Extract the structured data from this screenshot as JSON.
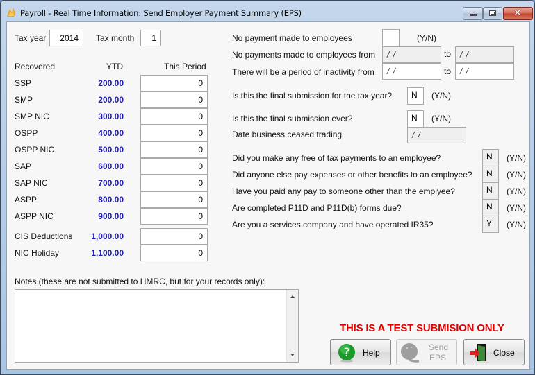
{
  "window": {
    "title": "Payroll - Real Time Information: Send Employer Payment Summary (EPS)",
    "app_icon": "payroll-flame-icon",
    "controls": {
      "minimize": "minimize-icon",
      "maximize": "maximize-icon",
      "close": "close-icon"
    }
  },
  "period": {
    "tax_year_label": "Tax year",
    "tax_year": "2014",
    "tax_month_label": "Tax month",
    "tax_month": "1"
  },
  "recovered": {
    "headers": {
      "item": "Recovered",
      "ytd": "YTD",
      "this_period": "This Period"
    },
    "rows": [
      {
        "label": "SSP",
        "ytd": "200.00",
        "this_period": "0"
      },
      {
        "label": "SMP",
        "ytd": "200.00",
        "this_period": "0"
      },
      {
        "label": "SMP NIC",
        "ytd": "300.00",
        "this_period": "0"
      },
      {
        "label": "OSPP",
        "ytd": "400.00",
        "this_period": "0"
      },
      {
        "label": "OSPP NIC",
        "ytd": "500.00",
        "this_period": "0"
      },
      {
        "label": "SAP",
        "ytd": "600.00",
        "this_period": "0"
      },
      {
        "label": "SAP NIC",
        "ytd": "700.00",
        "this_period": "0"
      },
      {
        "label": "ASPP",
        "ytd": "800.00",
        "this_period": "0"
      },
      {
        "label": "ASPP NIC",
        "ytd": "900.00",
        "this_period": "0"
      }
    ],
    "extra_rows": [
      {
        "label": "CIS Deductions",
        "ytd": "1,000.00",
        "this_period": "0"
      },
      {
        "label": "NIC Holiday",
        "ytd": "1,100.00",
        "this_period": "0"
      }
    ]
  },
  "payments": {
    "no_payment_label": "No payment made to employees",
    "no_payment_value": "",
    "yn_hint": "(Y/N)",
    "no_payments_from_label": "No payments made to employees from",
    "no_payments_from": " / /",
    "to_label": "to",
    "no_payments_to": " / /",
    "inactivity_label": "There will be a period of inactivity from",
    "inactivity_from": " / /",
    "inactivity_to": " / /"
  },
  "final": {
    "final_tax_year_label": "Is this the final submission for the tax year?",
    "final_tax_year": "N",
    "final_ever_label": "Is this the final submission ever?",
    "final_ever": "N",
    "ceased_label": "Date business ceased trading",
    "ceased_date": " / /"
  },
  "questions": [
    {
      "label": "Did you make any free of tax payments to an employee?",
      "value": "N"
    },
    {
      "label": "Did anyone else pay expenses or other benefits to an employee?",
      "value": "N"
    },
    {
      "label": "Have you paid any pay to someone other than the emplyee?",
      "value": "N"
    },
    {
      "label": "Are completed P11D and P11D(b) forms due?",
      "value": "N"
    },
    {
      "label": "Are you a services company and have operated IR35?",
      "value": "Y"
    }
  ],
  "notes": {
    "label": "Notes (these are not submitted to HMRC, but for your records only):",
    "value": ""
  },
  "warning": "THIS IS A TEST SUBMISION ONLY",
  "buttons": {
    "help": "Help",
    "send_line1": "Send",
    "send_line2": "EPS",
    "close": "Close"
  },
  "colors": {
    "ytd_blue": "#1b1bb0",
    "warning_red": "#e00000"
  }
}
